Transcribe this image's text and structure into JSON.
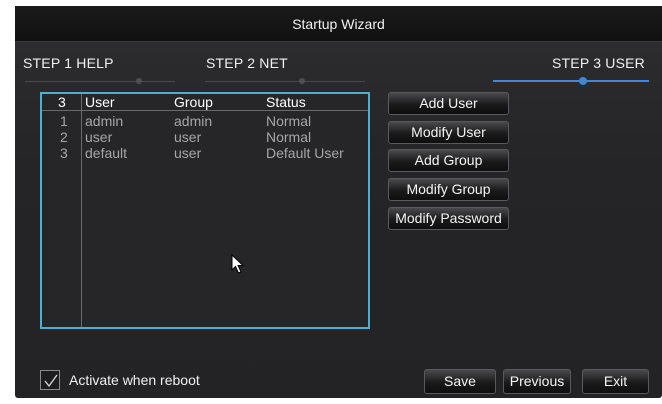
{
  "window": {
    "title": "Startup Wizard"
  },
  "steps": [
    {
      "label": "STEP 1 HELP",
      "active": false
    },
    {
      "label": "STEP 2 NET",
      "active": false
    },
    {
      "label": "STEP 3 USER",
      "active": true
    }
  ],
  "user_table": {
    "count": "3",
    "columns": [
      "User",
      "Group",
      "Status"
    ],
    "rows": [
      {
        "index": "1",
        "user": "admin",
        "group": "admin",
        "status": "Normal"
      },
      {
        "index": "2",
        "user": "user",
        "group": "user",
        "status": "Normal"
      },
      {
        "index": "3",
        "user": "default",
        "group": "user",
        "status": "Default User"
      }
    ]
  },
  "actions": {
    "add_user": "Add User",
    "modify_user": "Modify User",
    "add_group": "Add Group",
    "modify_group": "Modify Group",
    "modify_password": "Modify Password"
  },
  "footer": {
    "activate_label": "Activate when reboot",
    "activate_checked": true,
    "save": "Save",
    "previous": "Previous",
    "exit": "Exit"
  },
  "colors": {
    "accent": "#3f88d8",
    "table_border": "#4ab0d6",
    "background": "#262628"
  },
  "icons": [
    "checkmark-icon",
    "mouse-pointer-icon"
  ]
}
